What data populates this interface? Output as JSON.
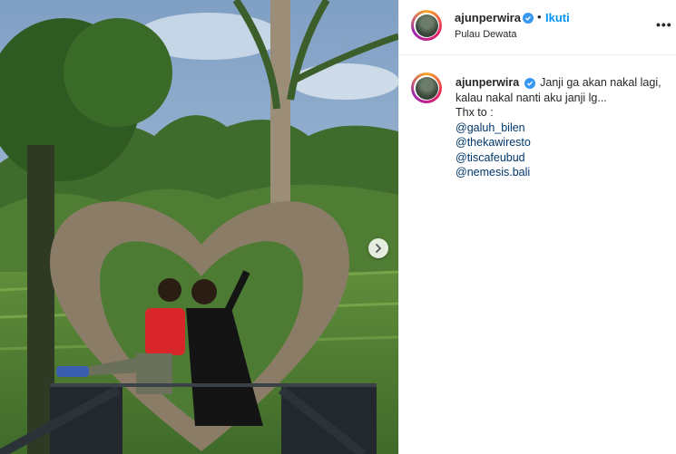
{
  "post": {
    "username": "ajunperwira",
    "follow_label": "Ikuti",
    "separator": "•",
    "location": "Pulau Dewata",
    "more_label": "•••"
  },
  "caption": {
    "username": "ajunperwira",
    "text": "Janji ga akan nakal lagi, kalau nakal nanti aku janji lg...",
    "thanks": "Thx to :",
    "mentions": [
      "@galuh_bilen",
      "@thekawiresto",
      "@tiscafeubud",
      "@nemesis.bali"
    ]
  },
  "icons": {
    "verified": "verified-badge-icon",
    "next": "chevron-right-icon",
    "more": "more-options-icon"
  },
  "colors": {
    "accent": "#0095f6",
    "mention": "#00376b",
    "verified": "#3897f0",
    "text": "#262626"
  }
}
